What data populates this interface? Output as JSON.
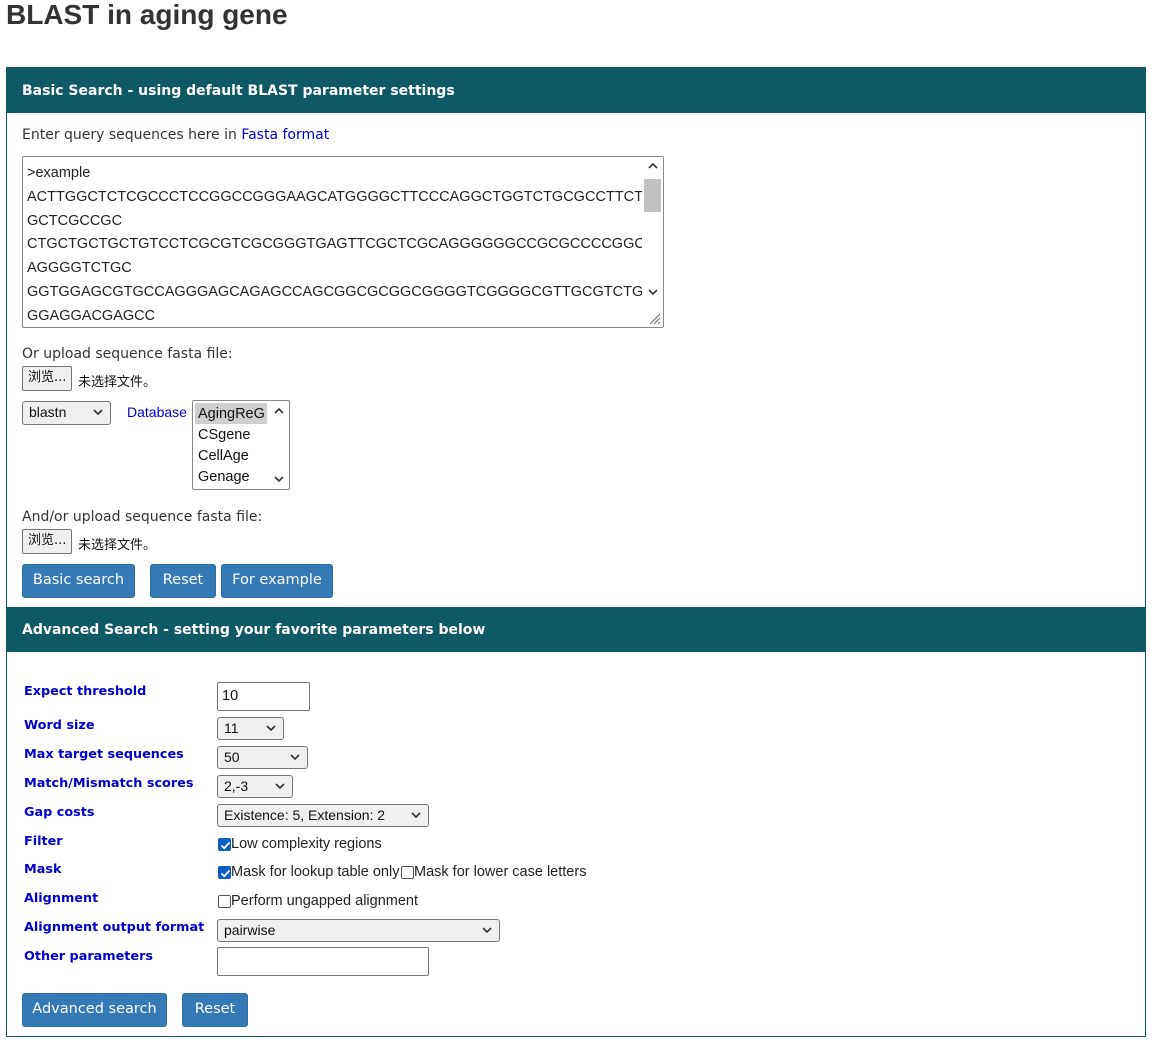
{
  "page": {
    "title": "BLAST in aging gene"
  },
  "basic": {
    "header": "Basic Search - using default BLAST parameter settings",
    "query_prompt": "Enter query sequences here in ",
    "fasta_link": "Fasta format",
    "sequence_lines": [
      ">example",
      "ACTTGGCTCTCGCCCTCCGGCCGGGAAGCATGGGGCTTCCCAGGCTGGTCTGCGCCTTCTT",
      "GCTCGCCGC",
      "CTGCTGCTGCTGTCCTCGCGTCGCGGGTGAGTTCGCTCGCAGGGGGGCCGCGCCCCGGCT",
      "AGGGGTCTGC",
      "GGTGGAGCGTGCCAGGGAGCAGAGCCAGCGGCGCGGCGGGGTCGGGGCGTTGCGTCTG",
      "GGAGGACGAGCC"
    ],
    "upload1_label": "Or upload sequence fasta file:",
    "browse_label": "浏览...",
    "no_file": "未选择文件。",
    "program_select": "blastn",
    "database_label": "Database",
    "databases": [
      "AgingReG",
      "CSgene",
      "CellAge",
      "Genage"
    ],
    "upload2_label": "And/or upload sequence fasta file:",
    "buttons": {
      "basic_search": "Basic search",
      "reset": "Reset",
      "for_example": "For example"
    }
  },
  "advanced": {
    "header": "Advanced Search - setting your favorite parameters below",
    "labels": {
      "expect": "Expect threshold",
      "word_size": "Word size",
      "max_targets": "Max target sequences",
      "match_mismatch": "Match/Mismatch scores",
      "gap_costs": "Gap costs",
      "filter": "Filter",
      "mask": "Mask",
      "alignment": "Alignment",
      "output_format": "Alignment output format",
      "other": "Other parameters"
    },
    "values": {
      "expect": "10",
      "word_size": "11",
      "max_targets": "50",
      "match_mismatch": "2,-3",
      "gap_costs": "Existence: 5, Extension: 2",
      "output_format": "pairwise",
      "other": ""
    },
    "checkboxes": {
      "low_complexity": "Low complexity regions",
      "mask_lookup": "Mask for lookup table only",
      "mask_lowercase": "Mask for lower case letters",
      "ungapped": "Perform ungapped alignment"
    },
    "buttons": {
      "advanced_search": "Advanced search",
      "reset": "Reset"
    }
  },
  "colors": {
    "header_bg": "#0e5a64",
    "button_bg": "#337ab7",
    "label_blue": "#0000cc",
    "checkbox_on": "#0b5fc1"
  }
}
